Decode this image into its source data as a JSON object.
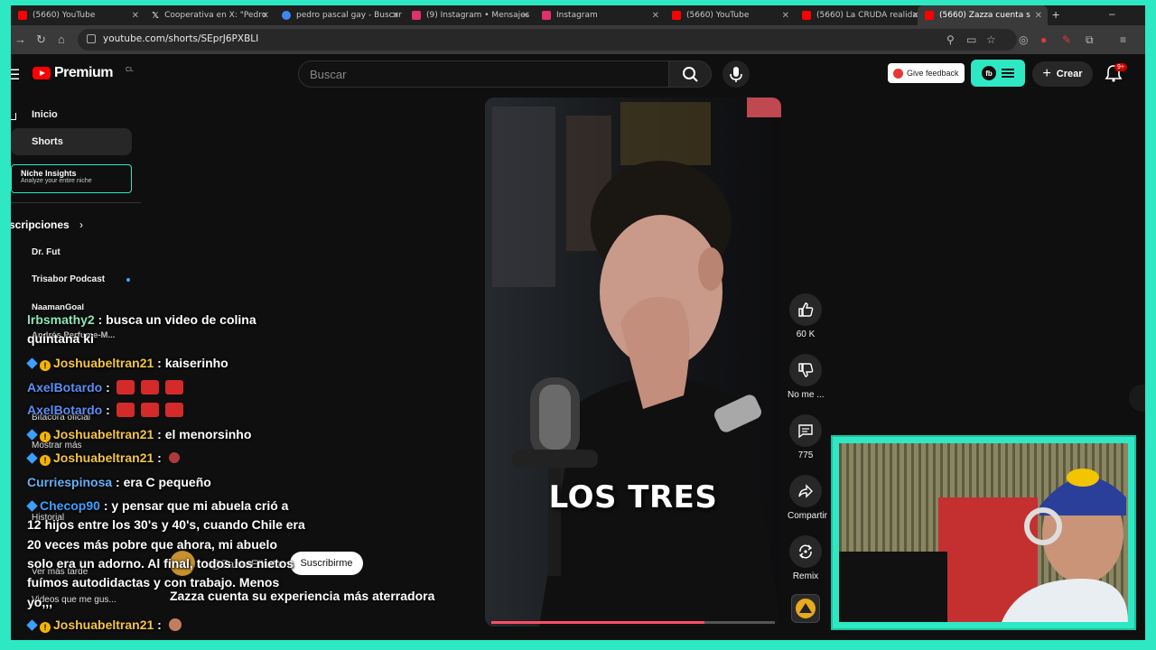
{
  "browser": {
    "tabs": [
      {
        "title": "(5660) YouTube",
        "favicon_color": "#ff0000",
        "active": false
      },
      {
        "title": "Cooperativa en X: \"Pedro",
        "favicon_color": "#ffffff",
        "active": false
      },
      {
        "title": "pedro pascal gay - Buscar",
        "favicon_color": "#4285f4",
        "active": false
      },
      {
        "title": "(9) Instagram • Mensajes",
        "favicon_color": "#e1306c",
        "active": false
      },
      {
        "title": "Instagram",
        "favicon_color": "#e1306c",
        "active": false
      },
      {
        "title": "(5660) YouTube",
        "favicon_color": "#ff0000",
        "active": false
      },
      {
        "title": "(5660) La CRUDA realidad",
        "favicon_color": "#ff0000",
        "active": false
      },
      {
        "title": "(5660) Zazza cuenta s",
        "favicon_color": "#ff0000",
        "active": true
      }
    ],
    "url": "youtube.com/shorts/SEprJ6PXBLI"
  },
  "youtube": {
    "brand": "Premium",
    "region": "CL",
    "search_placeholder": "Buscar",
    "feedback_label": "Give feedback",
    "niche_badge": "fb",
    "crear_label": "Crear",
    "notif_count": "9+"
  },
  "sidebar": {
    "inicio": "Inicio",
    "shorts": "Shorts",
    "niche_title": "Niche Insights",
    "niche_sub": "Analyze your entire niche",
    "subs_head": "scripciones",
    "subs": [
      "Dr. Fut",
      "Trisabor Podcast",
      "NaamanGoal",
      "Andrés Perfume-M..."
    ],
    "faint": [
      "Bitacora oficial",
      "Mostrar más",
      "Historial",
      "Ver más tarde",
      "Videos que me gus..."
    ]
  },
  "chat": [
    {
      "user": "lrbsmathy2",
      "msg": ": busca un video de colina",
      "cont": "quintana ki"
    },
    {
      "user": "Joshuabeltran21",
      "msg": ": kaiserinho"
    },
    {
      "user": "AxelBotardo",
      "msg": ":"
    },
    {
      "user": "AxelBotardo",
      "msg": ":"
    },
    {
      "user": "Joshuabeltran21",
      "msg": ": el menorsinho"
    },
    {
      "user": "Joshuabeltran21",
      "msg": ":"
    },
    {
      "user": "Curriespinosa",
      "msg": ": era C pequeño"
    },
    {
      "user": "Checop90",
      "msg": ": y pensar que mi abuela crió a",
      "cont_lines": [
        "12 hijos entre los 30's y 40's, cuando Chile era",
        "20 veces más pobre que ahora, mi abuelo",
        "solo era un adorno. Al final, todos los nietos",
        "fuímos autodidactas y con trabajo. Menos",
        "yo,,,"
      ]
    },
    {
      "user": "Joshuabeltran21",
      "msg": ":"
    }
  ],
  "video": {
    "caption": "LOS TRES",
    "title": "Zazza cuenta su experiencia más aterradora",
    "subscribe": "Suscribirme",
    "channel": "@ZazzaElItaliano",
    "progress": 0.75
  },
  "actions": {
    "likes": "60 K",
    "dislike": "No me ...",
    "comments": "775",
    "share": "Compartir",
    "remix": "Remix"
  },
  "colors": {
    "frame_bg": "#2ee8c4",
    "yt_red": "#ff0000"
  }
}
